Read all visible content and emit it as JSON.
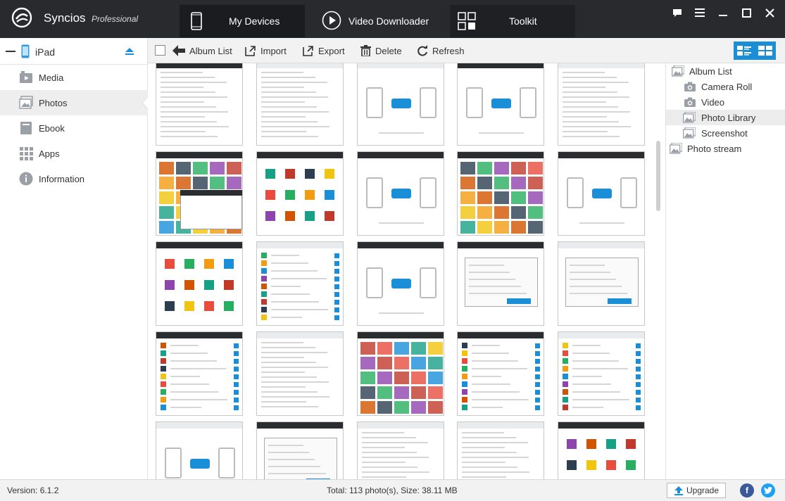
{
  "app": {
    "name": "Syncios",
    "edition": "Professional",
    "colors": {
      "titlebar": "#282a2e",
      "accent": "#1a8fd8",
      "active_tab": "#1b1c1f"
    }
  },
  "nav_tabs": [
    {
      "label": "My Devices",
      "icon": "phone-icon",
      "active": true
    },
    {
      "label": "Video Downloader",
      "icon": "play-icon",
      "active": false
    },
    {
      "label": "Toolkit",
      "icon": "grid-icon",
      "active": false
    }
  ],
  "window_controls": [
    "chat-icon",
    "menu-icon",
    "minimize-icon",
    "maximize-icon",
    "close-icon"
  ],
  "device": {
    "name": "iPad",
    "icon": "ipad-icon"
  },
  "sidebar": {
    "items": [
      {
        "label": "Media",
        "icon": "media-icon",
        "active": false
      },
      {
        "label": "Photos",
        "icon": "photos-icon",
        "active": true
      },
      {
        "label": "Ebook",
        "icon": "ebook-icon",
        "active": false
      },
      {
        "label": "Apps",
        "icon": "apps-icon",
        "active": false
      },
      {
        "label": "Information",
        "icon": "info-icon",
        "active": false
      }
    ]
  },
  "toolbar": {
    "album_list": "Album List",
    "import": "Import",
    "export": "Export",
    "delete": "Delete",
    "refresh": "Refresh"
  },
  "albums": [
    {
      "label": "Album List",
      "level": 0,
      "active": false
    },
    {
      "label": "Camera Roll",
      "level": 1,
      "active": false
    },
    {
      "label": "Video",
      "level": 1,
      "active": false
    },
    {
      "label": "Photo Library",
      "level": 1,
      "active": true
    },
    {
      "label": "Screenshot",
      "level": 1,
      "active": false
    },
    {
      "label": "Photo stream",
      "level": 0,
      "active": false
    }
  ],
  "thumbnails": [
    "table-screenshot",
    "device-list-screenshot",
    "connect-screenshot",
    "transfer-screenshot",
    "list-screenshot",
    "photo-export-screenshot",
    "toolkit-screenshot",
    "transfer-screenshot",
    "photo-grid-screenshot",
    "phone-transfer-screenshot",
    "toolkit-screenshot",
    "app-list-screenshot",
    "phone-transfer-screenshot",
    "settings-screenshot",
    "dialog-screenshot",
    "ringtone-screenshot",
    "table-screenshot",
    "photo-grid-screenshot",
    "app-list-screenshot",
    "app-list-screenshot",
    "phone-transfer-screenshot",
    "dialog-screenshot",
    "table-screenshot",
    "table-screenshot",
    "toolkit-screenshot"
  ],
  "status": {
    "version": "Version: 6.1.2",
    "total": "Total: 113 photo(s), Size: 38.11 MB",
    "upgrade": "Upgrade"
  }
}
